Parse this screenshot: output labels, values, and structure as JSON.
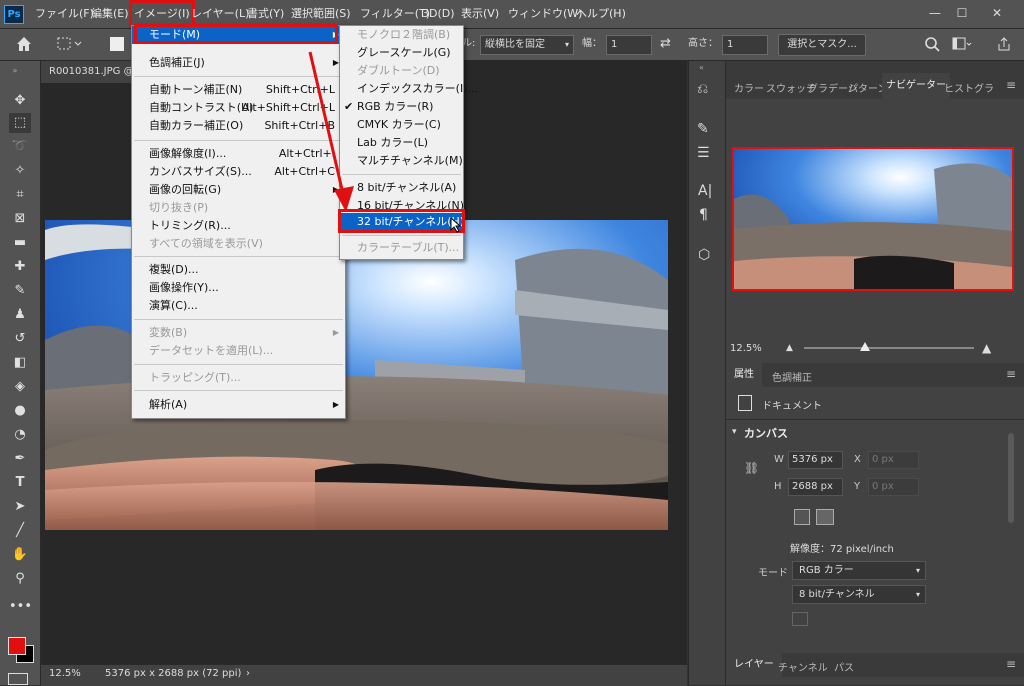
{
  "menubar": {
    "logo": "Ps",
    "items": [
      "ファイル(F)",
      "編集(E)",
      "イメージ(I)",
      "レイヤー(L)",
      "書式(Y)",
      "選択範囲(S)",
      "フィルター(T)",
      "3D(D)",
      "表示(V)",
      "ウィンドウ(W)",
      "ヘルプ(H)"
    ],
    "window_buttons": [
      "—",
      "☐",
      "✕"
    ]
  },
  "options": {
    "style_label": "ル:",
    "style_value": "縦横比を固定",
    "width_label": "幅：",
    "width_value": "1",
    "height_label": "高さ：",
    "height_value": "1",
    "select_mask_button": "選択とマスク..."
  },
  "document": {
    "tab_title": "R0010381.JPG @",
    "zoom": "12.5%",
    "info": "5376 px x 2688 px (72 ppi)"
  },
  "image_menu": {
    "items": [
      {
        "label": "モード(M)",
        "shortcut": "",
        "submenu": true,
        "highlighted": true
      },
      {
        "label": "色調補正(J)",
        "shortcut": "",
        "submenu": true
      },
      {
        "label": "自動トーン補正(N)",
        "shortcut": "Shift+Ctrl+L"
      },
      {
        "label": "自動コントラスト(U)",
        "shortcut": "Alt+Shift+Ctrl+L"
      },
      {
        "label": "自動カラー補正(O)",
        "shortcut": "Shift+Ctrl+B"
      },
      {
        "label": "画像解像度(I)...",
        "shortcut": "Alt+Ctrl+I"
      },
      {
        "label": "カンバスサイズ(S)...",
        "shortcut": "Alt+Ctrl+C"
      },
      {
        "label": "画像の回転(G)",
        "shortcut": "",
        "submenu": true
      },
      {
        "label": "切り抜き(P)",
        "shortcut": "",
        "disabled": true
      },
      {
        "label": "トリミング(R)...",
        "shortcut": ""
      },
      {
        "label": "すべての領域を表示(V)",
        "shortcut": "",
        "disabled": true
      },
      {
        "label": "複製(D)...",
        "shortcut": ""
      },
      {
        "label": "画像操作(Y)...",
        "shortcut": ""
      },
      {
        "label": "演算(C)...",
        "shortcut": ""
      },
      {
        "label": "変数(B)",
        "shortcut": "",
        "submenu": true,
        "disabled": true
      },
      {
        "label": "データセットを適用(L)...",
        "shortcut": "",
        "disabled": true
      },
      {
        "label": "トラッピング(T)...",
        "shortcut": "",
        "disabled": true
      },
      {
        "label": "解析(A)",
        "shortcut": "",
        "submenu": true
      }
    ]
  },
  "mode_menu": {
    "items": [
      {
        "label": "モノクロ２階調(B)",
        "disabled": true
      },
      {
        "label": "グレースケール(G)"
      },
      {
        "label": "ダブルトーン(D)",
        "disabled": true
      },
      {
        "label": "インデックスカラー(I)..."
      },
      {
        "label": "RGB カラー(R)",
        "checked": true
      },
      {
        "label": "CMYK カラー(C)"
      },
      {
        "label": "Lab カラー(L)"
      },
      {
        "label": "マルチチャンネル(M)"
      },
      {
        "label": "8 bit/チャンネル(A)"
      },
      {
        "label": "16 bit/チャンネル(N)"
      },
      {
        "label": "32 bit/チャンネル(H)",
        "highlighted": true
      },
      {
        "label": "カラーテーブル(T)...",
        "disabled": true
      }
    ],
    "check_mark": "✔"
  },
  "panels": {
    "top_tabs": [
      "カラー",
      "スウォッチ",
      "グラデーシ",
      "パターン",
      "ナビゲーター",
      "ヒストグラ"
    ],
    "nav_zoom": "12.5%",
    "props_tabs": [
      "属性",
      "色調補正"
    ],
    "document_label": "ドキュメント",
    "canvas_section": "カンバス",
    "w_label": "W",
    "w_value": "5376 px",
    "h_label": "H",
    "h_value": "2688 px",
    "x_label": "X",
    "x_placeholder": "0 px",
    "y_label": "Y",
    "y_placeholder": "0 px",
    "resolution": "解像度：72 pixel/inch",
    "mode_label": "モード",
    "mode_value": "RGB カラー",
    "bit_value": "8 bit/チャンネル",
    "bottom_tabs": [
      "レイヤー",
      "チャンネル",
      "パス"
    ]
  },
  "colors": {
    "highlight_red": "#e01010",
    "menu_highlight_blue": "#0a64c8",
    "foreground": "#e01010",
    "background": "#000000"
  }
}
